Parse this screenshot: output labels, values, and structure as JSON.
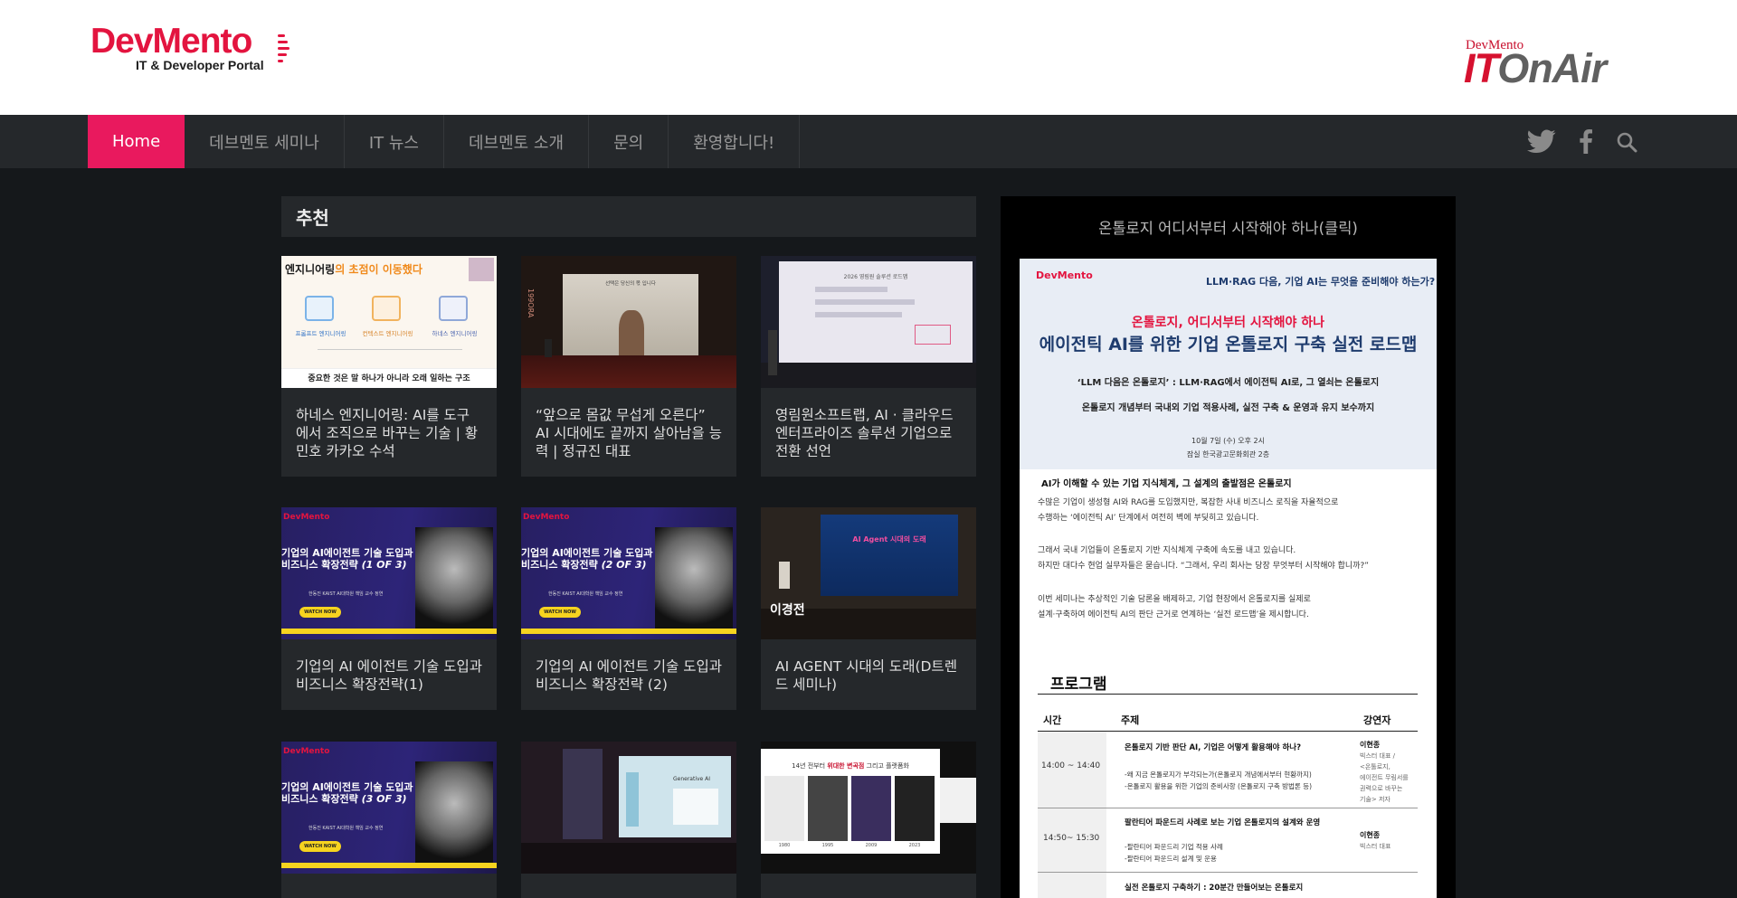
{
  "brand": {
    "logo_word": "DevMento",
    "logo_sub": "IT & Developer Portal",
    "onair_small": "DevMento",
    "onair_it": "IT",
    "onair_rest": "OnAir"
  },
  "nav": {
    "items": [
      "Home",
      "데브멘토 세미나",
      "IT 뉴스",
      "데브멘토 소개",
      "문의",
      "환영합니다!"
    ],
    "icons": [
      "twitter-icon",
      "facebook-icon",
      "search-icon"
    ]
  },
  "section": {
    "title": "추천"
  },
  "cards": [
    {
      "title": "하네스 엔지니어링: AI를 도구에서 조직으로 바꾸는 기술 | 황민호 카카오 수석"
    },
    {
      "title": "“앞으로 몸값 무섭게 오른다” AI 시대에도 끝까지 살아남을 능력 | 정규진 대표"
    },
    {
      "title": "영림원소프트랩, AI · 클라우드 엔터프라이즈 솔루션 기업으로 전환 선언"
    },
    {
      "title": "기업의 AI 에이전트 기술 도입과 비즈니스 확장전략(1)"
    },
    {
      "title": "기업의 AI 에이전트 기술 도입과 비즈니스 확장전략 (2)"
    },
    {
      "title": "AI AGENT 시대의 도래(D트렌드 세미나)"
    },
    {
      "title": ""
    },
    {
      "title": ""
    },
    {
      "title": ""
    }
  ],
  "thumbs": {
    "t1_head_a": "엔지니어링",
    "t1_head_b": "의 초점이 이동했다",
    "t1_col1": "프롬프트 엔지니어링",
    "t1_col2": "컨텍스트 엔지니어링",
    "t1_col3": "하네스 엔지니어링",
    "t1_foot": "중요한 것은 말 하나가 아니라 오래 일하는 구조",
    "t2_screen": "선택은 당신의 몫 입니다",
    "t2_left": "199ORA",
    "t3_screen": "2026 영림원 솔루션 로드맵",
    "purple_brand": "DevMento",
    "purple_title1": "기업의 AI에이전트 기술 도입과",
    "purple_title2a": "비즈니스 확장전략 ",
    "purple_part1": "(1 OF 3)",
    "purple_part2": "(2 OF 3)",
    "purple_part3": "(3 OF 3)",
    "purple_speaker": "한동진 KAIST AI대학원 책임 교수 정연",
    "purple_btn": "WATCH NOW",
    "t6_screen": "AI Agent 시대의 도래",
    "t6_name": "이경전",
    "t8_screen": "Generative AI",
    "t9_head_a": "14년 전부터 ",
    "t9_head_b": "위대한 변곡점",
    "t9_head_c": " 그리고 플랫폼화",
    "t9_years": [
      "1980",
      "1995",
      "2009",
      "2023"
    ]
  },
  "sidebar": {
    "title": "온톨로지 어디서부터 시작해야 하나(클릭)",
    "poster": {
      "brand": "DevMento",
      "q": "LLM·RAG 다음, 기업 AI는 무엇을 준비해야 하는가?",
      "h1": "온톨로지, 어디서부터 시작해야 하나",
      "h2": "에이전틱 AI를 위한 기업 온톨로지 구축 실전 로드맵",
      "s1": "‘LLM 다음은 온톨로지’ : LLM·RAG에서 에이전틱 AI로, 그 열쇠는 온톨로지",
      "s2": "온톨로지 개념부터 국내외 기업 적용사례, 실전 구축 & 운영과 유지 보수까지",
      "date": "10월 7일 (수) 오후 2시",
      "venue": "잠실 한국광고문화회관 2층",
      "b_title": "AI가 이해할 수 있는 기업 지식체계, 그 설계의 출발점은 온톨로지",
      "b1": "수많은 기업이 생성형 AI와 RAG를 도입했지만, 복잡한 사내 비즈니스 로직을 자율적으로",
      "b2": "수행하는 ‘에이전틱 AI’ 단계에서 여전히 벽에 부딪히고 있습니다.",
      "b3": "그래서 국내 기업들이 온톨로지 기반 지식체계 구축에 속도를 내고 있습니다.",
      "b4": "하지만 대다수 현업 실무자들은 묻습니다. “그래서, 우리 회사는 당장 무엇부터 시작해야 합니까?”",
      "b5": "이번 세미나는 추상적인 기술 담론을 배제하고, 기업 현장에서 온톨로지를 실제로",
      "b6": "설계·구축하여 에이전틱 AI의 판단 근거로 연계하는 ‘실전 로드맵’을 제시합니다.",
      "program": "프로그램",
      "col_time": "시간",
      "col_topic": "주제",
      "col_speaker": "강연자",
      "r1_time": "14:00 ~ 14:40",
      "r1_topic": "온톨로지 기반 판단 AI, 기업은 어떻게 활용해야 하나?",
      "r1_d1": "-왜 지금 온톨로지가 부각되는가(온톨로지 개념에서부터 현황까지)",
      "r1_d2": "-온톨로지 활용을 위한 기업의 준비사항 (온톨로지 구축 방법론 등)",
      "r1_sp1": "이현종",
      "r1_sp2": "빅스터 대표 /",
      "r1_sp3": "<온톨로지,",
      "r1_sp4": "에이전트 무림서를",
      "r1_sp5": "권력으로 바꾸는",
      "r1_sp6": "기술> 저자",
      "r2_time": "14:50~ 15:30",
      "r2_topic": "팔란티어 파운드리 사례로 보는 기업 온톨로지의 설계와 운영",
      "r2_d1": "-팔란티어 파운드리 기업 적용 사례",
      "r2_d2": "-팔란티어 파운드리 설계 및 운용",
      "r2_sp1": "이현종",
      "r2_sp2": "빅스터 대표",
      "r3_topic": "실전 온톨로지 구축하기 : 20분간 만들어보는 온톨로지"
    }
  },
  "colors": {
    "accent": "#e9195e",
    "brand_red": "#e3143f",
    "nav_bg": "#25282b",
    "page_bg": "#15181b"
  }
}
